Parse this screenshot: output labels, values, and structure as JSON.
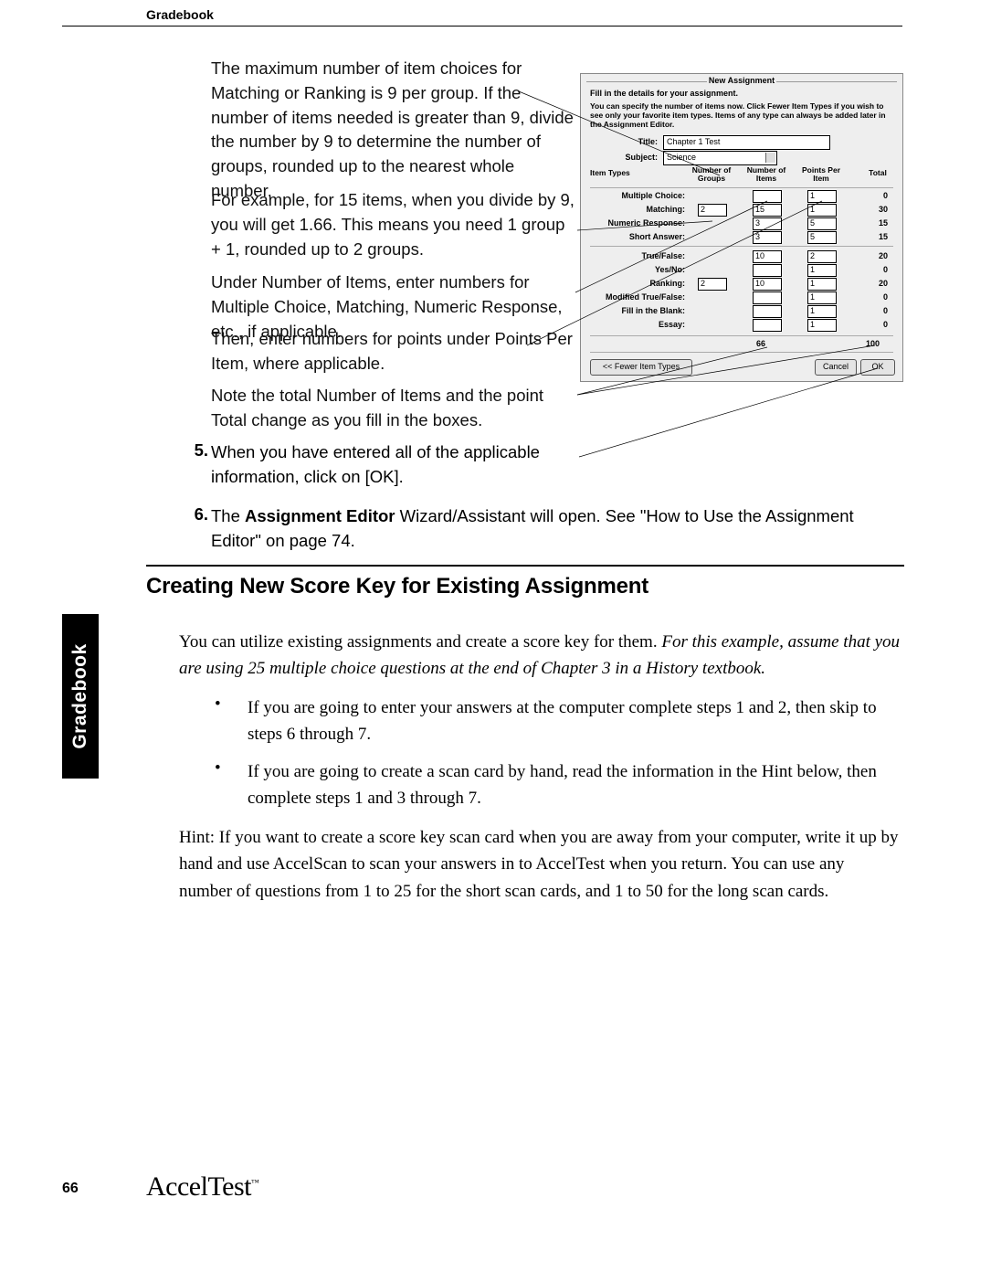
{
  "header": {
    "running_title": "Gradebook"
  },
  "sidebar": {
    "tab_label": "Gradebook"
  },
  "footer": {
    "page_number": "66",
    "product_name": "AccelTest",
    "tm": "™"
  },
  "body": {
    "p1": "The maximum number of item choices for Matching or Ranking is 9 per group. If the number of items needed is greater than 9, divide the number by 9 to determine the number of groups, rounded up to the nearest whole number.",
    "p2": "For example, for 15 items, when you divide by 9, you will get 1.66. This means you need 1 group + 1, rounded up to 2 groups.",
    "p3": "Under Number of Items, enter numbers for Multiple Choice, Matching, Numeric Response, etc., if applicable.",
    "p4": "Then, enter numbers for points under Points Per Item, where applicable.",
    "p5": "Note the total Number of Items and the point Total change as you fill in the boxes.",
    "step5_num": "5.",
    "step5_text": "When you have entered all of the applicable information, click on [OK].",
    "step6_num": "6.",
    "step6_pre": "The ",
    "step6_bold": "Assignment Editor",
    "step6_post": " Wizard/Assistant will open. See \"How to Use the Assignment Editor\" on page 74.",
    "section_heading": "Creating New Score Key for Existing Assignment",
    "s_p1a": "You can utilize existing assignments and create a score key for them. ",
    "s_p1b_italic": "For this example, assume that you are using 25 multiple choice questions at the end of Chapter 3 in a History textbook.",
    "s_b1": "If you are going to enter your answers at the computer complete steps 1 and 2, then skip to steps 6 through 7.",
    "s_b2": "If you are going to create a scan card by hand, read the information in the Hint below, then complete steps 1 and 3 through 7.",
    "s_hint": "Hint: If you want to create a score key scan card when you are away from your computer, write it up by hand and use AccelScan to scan your answers in to AccelTest when you return. You can use any number of questions from 1 to 25 for the short scan cards, and 1 to 50 for the long scan cards."
  },
  "dialog": {
    "title": "New Assignment",
    "instr": "Fill in the details for your assignment.",
    "subtext": "You can specify the number of items now. Click Fewer Item Types if you wish to see only your favorite item types. Items of any type can always be added later in the Assignment Editor.",
    "title_label": "Title:",
    "title_value": "Chapter 1 Test",
    "subject_label": "Subject:",
    "subject_value": "Science",
    "col_itemtypes": "Item Types",
    "col_groups": "Number of\nGroups",
    "col_items": "Number of\nItems",
    "col_ppi": "Points Per\nItem",
    "col_total": "Total",
    "rows": [
      {
        "label": "Multiple Choice:",
        "groups": "",
        "items": "",
        "ppi": "1",
        "total": "0"
      },
      {
        "label": "Matching:",
        "groups": "2",
        "items": "15",
        "ppi": "1",
        "total": "30"
      },
      {
        "label": "Numeric Response:",
        "groups": "",
        "items": "3",
        "ppi": "5",
        "total": "15"
      },
      {
        "label": "Short Answer:",
        "groups": "",
        "items": "3",
        "ppi": "5",
        "total": "15"
      },
      {
        "label": "True/False:",
        "groups": "",
        "items": "10",
        "ppi": "2",
        "total": "20"
      },
      {
        "label": "Yes/No:",
        "groups": "",
        "items": "",
        "ppi": "1",
        "total": "0"
      },
      {
        "label": "Ranking:",
        "groups": "2",
        "items": "10",
        "ppi": "1",
        "total": "20"
      },
      {
        "label": "Modified True/False:",
        "groups": "",
        "items": "",
        "ppi": "1",
        "total": "0"
      },
      {
        "label": "Fill in the Blank:",
        "groups": "",
        "items": "",
        "ppi": "1",
        "total": "0"
      },
      {
        "label": "Essay:",
        "groups": "",
        "items": "",
        "ppi": "1",
        "total": "0"
      }
    ],
    "sum_items": "66",
    "sum_total": "100",
    "btn_fewer": "<< Fewer Item Types",
    "btn_cancel": "Cancel",
    "btn_ok": "OK"
  }
}
